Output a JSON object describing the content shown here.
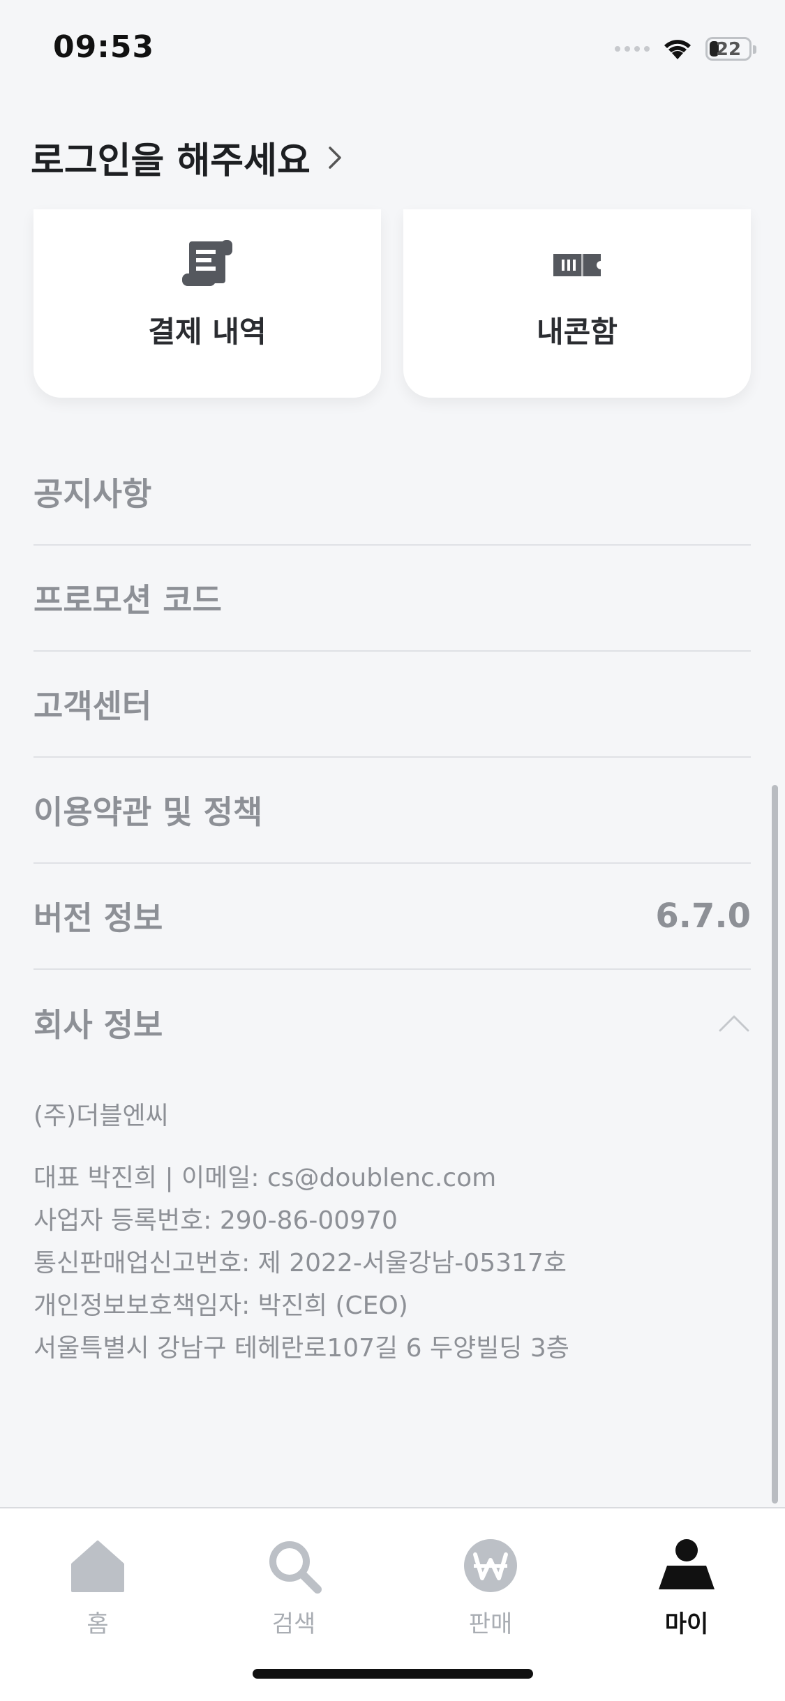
{
  "status_bar": {
    "time": "09:53",
    "battery": "22",
    "icons": [
      "signal-dots-icon",
      "wifi-icon",
      "battery-icon"
    ]
  },
  "header": {
    "login_prompt": "로그인을 해주세요"
  },
  "cards": [
    {
      "label": "결제 내역",
      "icon": "receipt-icon"
    },
    {
      "label": "내콘함",
      "icon": "ticket-icon"
    }
  ],
  "menu": {
    "notice": "공지사항",
    "promo_code": "프로모션 코드",
    "customer_center": "고객센터",
    "terms": "이용약관 및 정책",
    "version_label": "버전 정보",
    "version_value": "6.7.0",
    "company_info": "회사 정보"
  },
  "company": {
    "name": "(주)더블엔씨",
    "lines": [
      "대표 박진희 | 이메일: cs@doublenc.com",
      "사업자 등록번호: 290-86-00970",
      "통신판매업신고번호: 제 2022-서울강남-05317호",
      "개인정보보호책임자: 박진희 (CEO)",
      "서울특별시 강남구 테헤란로107길 6 두양빌딩 3층"
    ]
  },
  "tabbar": {
    "tabs": [
      {
        "label": "홈",
        "icon": "home-icon",
        "active": false
      },
      {
        "label": "검색",
        "icon": "search-icon",
        "active": false
      },
      {
        "label": "판매",
        "icon": "won-icon",
        "active": false
      },
      {
        "label": "마이",
        "icon": "person-icon",
        "active": true
      }
    ],
    "inactive_color": "#a9adb3",
    "active_color": "#111111"
  }
}
